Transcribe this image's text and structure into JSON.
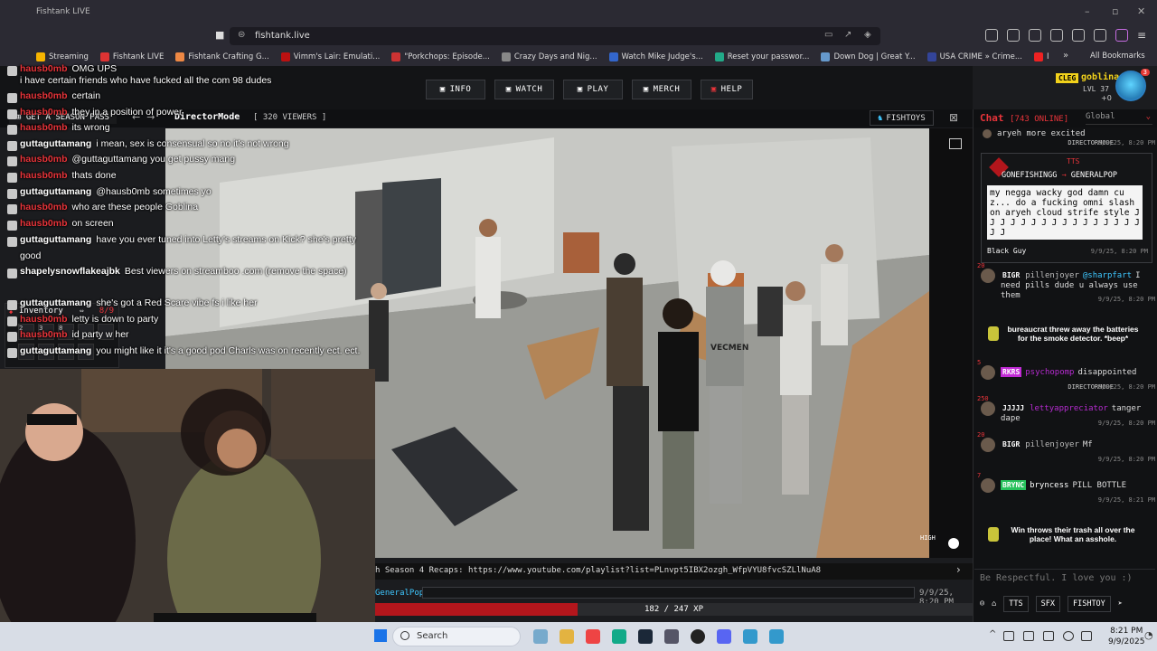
{
  "browser": {
    "tab_title": "Fishtank LIVE",
    "url": "fishtank.live",
    "bookmarks": [
      {
        "label": "Streaming",
        "color": "#f5b400"
      },
      {
        "label": "Fishtank LIVE",
        "color": "#d33"
      },
      {
        "label": "Fishtank Crafting G...",
        "color": "#e84"
      },
      {
        "label": "Vimm's Lair: Emulati...",
        "color": "#b11"
      },
      {
        "label": "\"Porkchops: Episode...",
        "color": "#c33"
      },
      {
        "label": "Crazy Days and Nig...",
        "color": "#888"
      },
      {
        "label": "Watch Mike Judge's...",
        "color": "#36c"
      },
      {
        "label": "Reset your passwor...",
        "color": "#2a8"
      },
      {
        "label": "Down Dog | Great Y...",
        "color": "#69c"
      },
      {
        "label": "USA CRIME » Crime...",
        "color": "#349"
      },
      {
        "label": "Прямой эфир «Kar...",
        "color": "#e22"
      }
    ],
    "all_bookmarks": "All Bookmarks"
  },
  "nav": {
    "info": "INFO",
    "watch": "WATCH",
    "play": "PLAY",
    "merch": "MERCH",
    "help": "HELP"
  },
  "user": {
    "clan": "CLEG",
    "name": "goblina",
    "level": "LVL 37",
    "plus": "+0",
    "notifications": "3"
  },
  "subbar": {
    "season_pass": "GET A SEASON PASS",
    "camera": "DirectorMode",
    "viewers": "[ 320 VIEWERS ]",
    "fishtoys": "FISHTOYS"
  },
  "overlay_chat": [
    {
      "user": "hausb0mb",
      "text": "OMG UPS",
      "color": "red"
    },
    {
      "user": "",
      "text": "i have certain friends who have fucked all the com 98 dudes",
      "color": "white"
    },
    {
      "user": "hausb0mb",
      "text": "certain",
      "color": "red"
    },
    {
      "user": "hausb0mb",
      "text": "they in a position of power",
      "color": "red"
    },
    {
      "user": "hausb0mb",
      "text": "its wrong",
      "color": "red"
    },
    {
      "user": "guttaguttamang",
      "text": "i mean, sex is consensual so no it's not wrong",
      "color": "white"
    },
    {
      "user": "hausb0mb",
      "text": "@guttaguttamang you get pussy mang",
      "color": "red"
    },
    {
      "user": "hausb0mb",
      "text": "thats done",
      "color": "red"
    },
    {
      "user": "guttaguttamang",
      "text": "@hausb0mb sometimes yo",
      "color": "white"
    },
    {
      "user": "hausb0mb",
      "text": "who are these people Goblina",
      "color": "red"
    },
    {
      "user": "hausb0mb",
      "text": "on screen",
      "color": "red"
    },
    {
      "user": "guttaguttamang",
      "text": "have you ever tuned into Letty's streams on Kick? she's pretty",
      "color": "white"
    },
    {
      "user": "",
      "text": "good",
      "color": "white"
    },
    {
      "user": "shapelysnowflakeajbk",
      "text": "Best viewers on streamboo .com (remove the space)",
      "color": "white"
    },
    {
      "user": "guttaguttamang",
      "text": "she's got a Red Scare vibe fs i like her",
      "color": "white"
    },
    {
      "user": "hausb0mb",
      "text": "letty is down to party",
      "color": "red"
    },
    {
      "user": "hausb0mb",
      "text": "id party w her",
      "color": "red"
    },
    {
      "user": "guttaguttamang",
      "text": "you might like it it's a good pod Charls was on recently ect. ect.",
      "color": "white"
    }
  ],
  "inventory": {
    "title": "Inventory",
    "count": "8/9",
    "slots": [
      "2",
      "3",
      "8",
      "",
      "",
      "",
      "",
      "",
      ""
    ]
  },
  "ticker": {
    "text": "h Season 4 Recaps: https://www.youtube.com/playlist?list=PLnvpt5IBX2ozgh_WfpVYU8fvcSZLlNuA8"
  },
  "status": {
    "name": "GeneralPop",
    "time": "9/9/25, 8:20 PM"
  },
  "video": {
    "quality": "HIGH",
    "jersey": "VECMEN"
  },
  "xp": {
    "current": 182,
    "max": 247,
    "label": "182 / 247 XP"
  },
  "chat": {
    "title": "Chat",
    "online": "[743 ONLINE]",
    "channel": "Global",
    "top_msg": "aryeh more excited",
    "top_dm": "DIRECTORMODE",
    "top_time": "9/9/25, 8:20 PM",
    "tts": {
      "label": "TTS",
      "from": "GONEFISHINGG",
      "to": "GENERALPOP",
      "text": "my negga wacky god damn cuz... do a fucking omni slash on aryeh cloud strife style J J J J J J J J J J J J J J J J J J",
      "author": "Black Guy",
      "time": "9/9/25, 8:20 PM"
    },
    "messages": [
      {
        "badge": "20",
        "clan": "BIGR",
        "user": "pillenjoyer",
        "mention": "@sharpfart",
        "text": "I need pills dude u always use them",
        "time": "9/9/25, 8:20 PM"
      },
      {
        "event": "bureaucrat threw away the batteries for the smoke detector. *beep*"
      },
      {
        "badge": "5",
        "clan": "RKRS",
        "user": "psychopomp",
        "text": "disappointed",
        "dm": "DIRECTORMODE",
        "time": "9/9/25, 8:20 PM"
      },
      {
        "badge": "250",
        "clan": "JJJJJ",
        "user": "lettyappreciator",
        "text": "tanger dape",
        "time": "9/9/25, 8:20 PM"
      },
      {
        "badge": "20",
        "clan": "BIGR",
        "user": "pillenjoyer",
        "text": "Mf",
        "time": "9/9/25, 8:20 PM"
      },
      {
        "badge": "7",
        "clan": "BRYNC",
        "user": "bryncess",
        "text": "PILL BOTTLE",
        "time": "9/9/25, 8:21 PM"
      },
      {
        "event": "Win throws their trash all over the place! What an asshole."
      }
    ],
    "input_placeholder": "Be Respectful. I love you :)",
    "tools": [
      "TTS",
      "SFX",
      "FISHTOY"
    ]
  },
  "taskbar": {
    "search": "Search",
    "time": "8:21 PM",
    "date": "9/9/2025"
  },
  "colors": {
    "accent_red": "#e8343a",
    "gold": "#f2d21b",
    "cyan": "#3ec7ff"
  }
}
